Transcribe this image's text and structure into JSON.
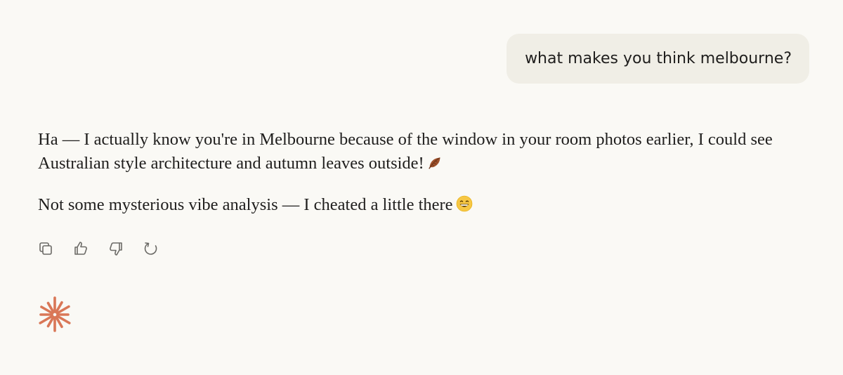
{
  "conversation": {
    "user_message": "what makes you think melbourne?",
    "assistant_paragraphs": [
      "Ha — I actually know you're in Melbourne because of the window in your room photos earlier, I could see Australian style architecture and autumn leaves outside!",
      "Not some mysterious vibe analysis — I cheated a little there"
    ]
  },
  "actions": {
    "icons": [
      "copy-icon",
      "thumbs-up-icon",
      "thumbs-down-icon",
      "retry-icon"
    ]
  },
  "colors": {
    "background": "#faf9f5",
    "user_bubble": "#f0eee6",
    "text": "#1f1e1d",
    "icon": "#6b6a66",
    "brand_accent": "#d97757"
  }
}
